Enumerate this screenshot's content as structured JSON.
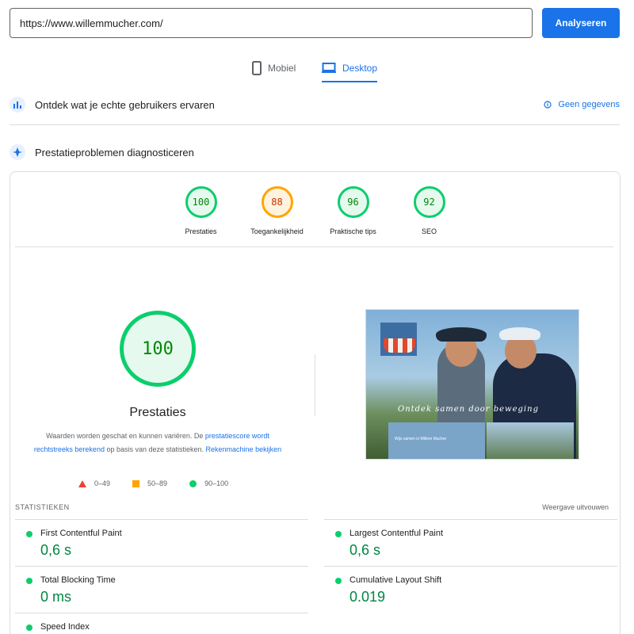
{
  "search": {
    "url": "https://www.willemmucher.com/",
    "button_label": "Analyseren"
  },
  "tabs": {
    "mobile": "Mobiel",
    "desktop": "Desktop",
    "active": "desktop"
  },
  "sections": {
    "field_data": {
      "title": "Ontdek wat je echte gebruikers ervaren",
      "no_data_label": "Geen gegevens"
    },
    "diagnostics": {
      "title": "Prestatieproblemen diagnosticeren"
    }
  },
  "scores": [
    {
      "label": "Prestaties",
      "value": "100",
      "status": "good"
    },
    {
      "label": "Toegankelijkheid",
      "value": "88",
      "status": "average"
    },
    {
      "label": "Praktische tips",
      "value": "96",
      "status": "good"
    },
    {
      "label": "SEO",
      "value": "92",
      "status": "good"
    }
  ],
  "performance": {
    "score": "100",
    "label": "Prestaties",
    "note_before": "Waarden worden geschat en kunnen variëren. De ",
    "note_link1": "prestatiescore wordt rechtstreeks berekend",
    "note_middle": " op basis van deze statistieken. ",
    "note_link2": "Rekenmachine bekijken"
  },
  "legend": [
    {
      "shape": "triangle",
      "range": "0–49",
      "color": "#eb4335"
    },
    {
      "shape": "square",
      "range": "50–89",
      "color": "#ffa400"
    },
    {
      "shape": "circle",
      "range": "90–100",
      "color": "#0cce6b"
    }
  ],
  "thumbnail": {
    "slogan": "Ontdek samen door beweging",
    "info_title": "Wijs samen is Willem Mucher"
  },
  "statistics": {
    "heading": "STATISTIEKEN",
    "expand_label": "Weergave uitvouwen",
    "metrics": [
      {
        "name": "First Contentful Paint",
        "value": "0,6 s"
      },
      {
        "name": "Largest Contentful Paint",
        "value": "0,6 s"
      },
      {
        "name": "Total Blocking Time",
        "value": "0 ms"
      },
      {
        "name": "Cumulative Layout Shift",
        "value": "0.019"
      },
      {
        "name": "Speed Index",
        "value": ""
      }
    ]
  },
  "colors": {
    "accent": "#1a73e8",
    "good": "#0cce6b",
    "average": "#ffa400",
    "poor": "#eb4335"
  }
}
